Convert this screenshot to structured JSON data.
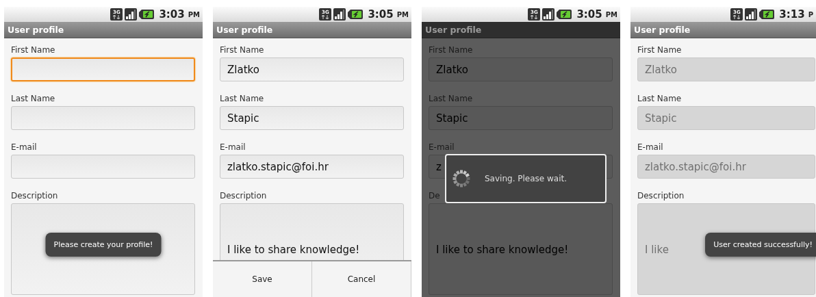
{
  "screens": [
    {
      "status": {
        "network": "3G",
        "time": "3:03",
        "meridiem": "PM"
      },
      "title": "User profile",
      "dimmed": false,
      "fields": [
        {
          "kind": "text",
          "label": "First Name",
          "focused": true,
          "disabled": false
        },
        {
          "kind": "text",
          "label": "Last Name",
          "focused": false,
          "disabled": false
        },
        {
          "kind": "text",
          "label": "E-mail",
          "focused": false,
          "disabled": false
        },
        {
          "kind": "multiline",
          "label": "Description",
          "focused": false,
          "disabled": false
        }
      ],
      "toast": "Please create your profile!"
    },
    {
      "status": {
        "network": "3G",
        "time": "3:05",
        "meridiem": "PM"
      },
      "title": "User profile",
      "dimmed": false,
      "fields": [
        {
          "kind": "text",
          "label": "First Name",
          "value": "Zlatko",
          "focused": false,
          "disabled": false
        },
        {
          "kind": "text",
          "label": "Last Name",
          "value": "Stapic",
          "focused": false,
          "disabled": false
        },
        {
          "kind": "text",
          "label": "E-mail",
          "value": "zlatko.stapic@foi.hr",
          "focused": false,
          "disabled": false
        },
        {
          "kind": "multiline",
          "label": "Description",
          "value": "I like to share knowledge!",
          "focused": false,
          "disabled": false
        }
      ],
      "menu": [
        "Save",
        "Cancel"
      ]
    },
    {
      "status": {
        "network": "3G",
        "time": "3:05",
        "meridiem": "PM"
      },
      "title": "User profile",
      "dimmed": true,
      "fields": [
        {
          "kind": "text",
          "label": "First Name",
          "value": "Zlatko",
          "focused": false,
          "disabled": false
        },
        {
          "kind": "text",
          "label": "Last Name",
          "value": "Stapic",
          "focused": false,
          "disabled": false
        },
        {
          "kind": "text",
          "label": "E-mail",
          "value": "z",
          "focused": false,
          "disabled": false
        },
        {
          "kind": "multiline",
          "label": "De",
          "value": "I like to share knowledge!",
          "focused": false,
          "disabled": false
        }
      ],
      "dialog": "Saving. Please wait."
    },
    {
      "status": {
        "network": "3G",
        "time": "3:13",
        "meridiem": "P"
      },
      "title": "User profile",
      "dimmed": false,
      "fields": [
        {
          "kind": "text",
          "label": "First Name",
          "value": "Zlatko",
          "focused": false,
          "disabled": true
        },
        {
          "kind": "text",
          "label": "Last Name",
          "value": "Stapic",
          "focused": false,
          "disabled": true
        },
        {
          "kind": "text",
          "label": "E-mail",
          "value": "zlatko.stapic@foi.hr",
          "focused": false,
          "disabled": true
        },
        {
          "kind": "multiline",
          "label": "Description",
          "value": "I like",
          "focused": false,
          "disabled": true
        }
      ],
      "toast": "User created successfully!"
    }
  ]
}
